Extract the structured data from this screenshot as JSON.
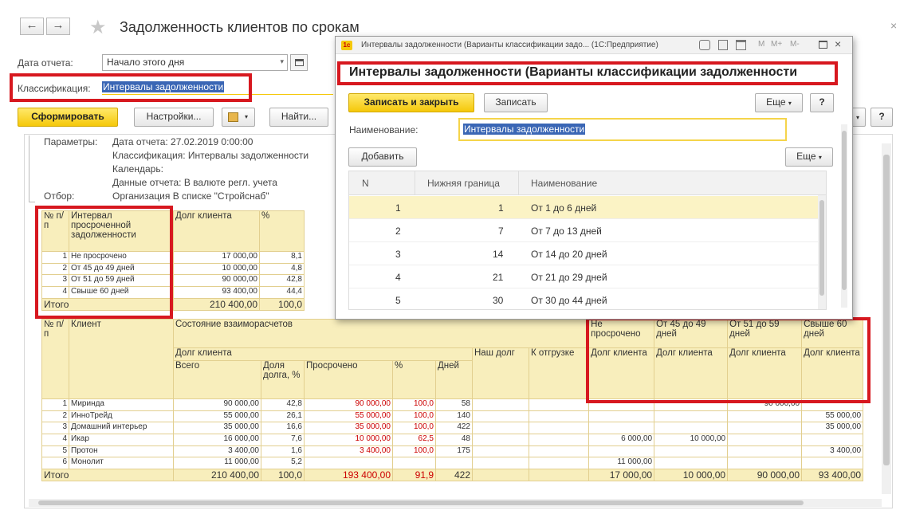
{
  "window": {
    "title": "Задолженность клиентов по срокам",
    "back_icon": "←",
    "forward_icon": "→",
    "star_icon": "★"
  },
  "form": {
    "report_date_label": "Дата отчета:",
    "report_date_value": "Начало этого дня",
    "classification_label": "Классификация:",
    "classification_value": "Интервалы задолженности"
  },
  "toolbar": {
    "generate_label": "Сформировать",
    "settings_label": "Настройки...",
    "find_label": "Найти...",
    "question_label": "?"
  },
  "params": {
    "label": "Параметры:",
    "filter_label": "Отбор:",
    "lines": [
      "Дата отчета: 27.02.2019 0:00:00",
      "Классификация: Интервалы задолженности",
      "Календарь:",
      "Данные отчета: В валюте регл. учета",
      "Организация В списке \"Стройснаб\""
    ]
  },
  "summary": {
    "headers": [
      "№ п/п",
      "Интервал просроченной задолженности",
      "Долг клиента",
      "%"
    ],
    "rows": [
      {
        "n": "1",
        "name": "Не просрочено",
        "debt": "17 000,00",
        "pct": "8,1"
      },
      {
        "n": "2",
        "name": "От 45 до 49 дней",
        "debt": "10 000,00",
        "pct": "4,8"
      },
      {
        "n": "3",
        "name": "От 51 до 59 дней",
        "debt": "90 000,00",
        "pct": "42,8"
      },
      {
        "n": "4",
        "name": "Свыше 60 дней",
        "debt": "93 400,00",
        "pct": "44,4"
      }
    ],
    "total_label": "Итого",
    "total_debt": "210 400,00",
    "total_pct": "100,0"
  },
  "detail": {
    "h_n": "№ п/п",
    "h_client": "Клиент",
    "h_state": "Состояние взаиморасчетов",
    "h_debt": "Долг клиента",
    "h_total": "Всего",
    "h_share": "Доля долга, %",
    "h_overdue": "Просрочено",
    "h_pct": "%",
    "h_days": "Дней",
    "h_ourdebt": "Наш долг",
    "h_toship": "К отгрузке",
    "h_int1": "Не просрочено",
    "h_int2": "От 45 до 49 дней",
    "h_int3": "От 51 до 59 дней",
    "h_int4": "Свыше 60 дней",
    "h_clientdebt": "Долг клиента",
    "rows": [
      {
        "n": "1",
        "client": "Миринда",
        "total": "90 000,00",
        "share": "42,8",
        "overdue": "90 000,00",
        "pct": "100,0",
        "days": "58",
        "i1": "",
        "i2": "",
        "i3": "90 000,00",
        "i4": ""
      },
      {
        "n": "2",
        "client": "ИнноТрейд",
        "total": "55 000,00",
        "share": "26,1",
        "overdue": "55 000,00",
        "pct": "100,0",
        "days": "140",
        "i1": "",
        "i2": "",
        "i3": "",
        "i4": "55 000,00"
      },
      {
        "n": "3",
        "client": "Домашний интерьер",
        "total": "35 000,00",
        "share": "16,6",
        "overdue": "35 000,00",
        "pct": "100,0",
        "days": "422",
        "i1": "",
        "i2": "",
        "i3": "",
        "i4": "35 000,00"
      },
      {
        "n": "4",
        "client": "Икар",
        "total": "16 000,00",
        "share": "7,6",
        "overdue": "10 000,00",
        "pct": "62,5",
        "days": "48",
        "i1": "6 000,00",
        "i2": "10 000,00",
        "i3": "",
        "i4": ""
      },
      {
        "n": "5",
        "client": "Протон",
        "total": "3 400,00",
        "share": "1,6",
        "overdue": "3 400,00",
        "pct": "100,0",
        "days": "175",
        "i1": "",
        "i2": "",
        "i3": "",
        "i4": "3 400,00"
      },
      {
        "n": "6",
        "client": "Монолит",
        "total": "11 000,00",
        "share": "5,2",
        "overdue": "",
        "pct": "",
        "days": "",
        "i1": "11 000,00",
        "i2": "",
        "i3": "",
        "i4": ""
      }
    ],
    "total_label": "Итого",
    "total": {
      "total": "210 400,00",
      "share": "100,0",
      "overdue": "193 400,00",
      "pct": "91,9",
      "days": "422",
      "i1": "17 000,00",
      "i2": "10 000,00",
      "i3": "90 000,00",
      "i4": "93 400,00"
    }
  },
  "dialog": {
    "window_title": "Интервалы задолженности (Варианты классификации задо...  (1С:Предприятие)",
    "header": "Интервалы задолженности (Варианты классификации задолженности",
    "save_close_label": "Записать и закрыть",
    "save_label": "Записать",
    "more_label": "Еще",
    "help_label": "?",
    "name_label": "Наименование:",
    "name_value": "Интервалы задолженности",
    "add_label": "Добавить",
    "tb_m": "M",
    "tb_mplus": "M+",
    "tb_mminus": "M-",
    "columns": [
      "N",
      "Нижняя граница",
      "Наименование"
    ],
    "rows": [
      {
        "n": "1",
        "lower": "1",
        "name": "От 1 до 6 дней"
      },
      {
        "n": "2",
        "lower": "7",
        "name": "От 7 до 13 дней"
      },
      {
        "n": "3",
        "lower": "14",
        "name": "От 14 до 20 дней"
      },
      {
        "n": "4",
        "lower": "21",
        "name": "От 21 до 29 дней"
      },
      {
        "n": "5",
        "lower": "30",
        "name": "От 30 до 44 дней"
      }
    ]
  },
  "colors": {
    "accent_yellow": "#f5c80a",
    "highlight_red": "#d7181f",
    "header_bg": "#f8eebc",
    "overdue_red": "#cc0000"
  }
}
